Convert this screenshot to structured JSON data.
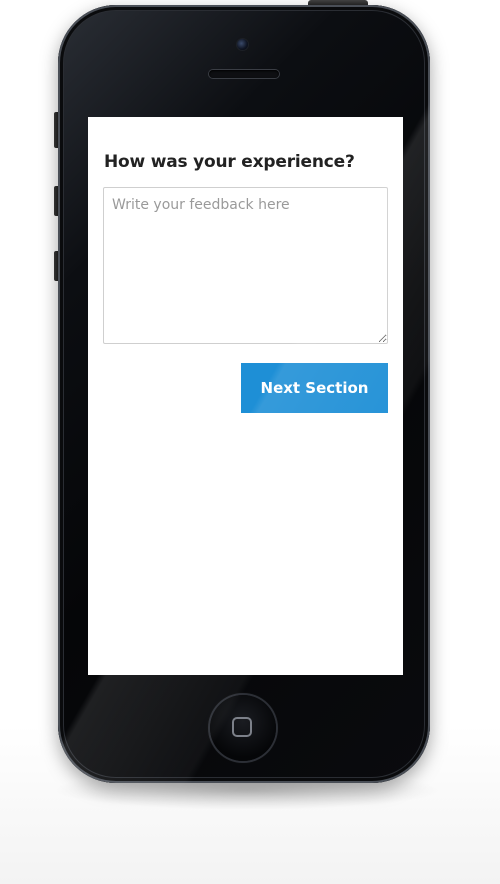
{
  "form": {
    "question": "How was your experience?",
    "feedback_placeholder": "Write your feedback here",
    "feedback_value": "",
    "next_button_label": "Next Section"
  },
  "theme": {
    "accent": "#1e8fd6",
    "device_body": "#050608",
    "screen_background": "#ffffff"
  },
  "icons": {
    "home": "home-button-icon",
    "camera": "front-camera-icon",
    "speaker": "earpiece-speaker-icon"
  }
}
